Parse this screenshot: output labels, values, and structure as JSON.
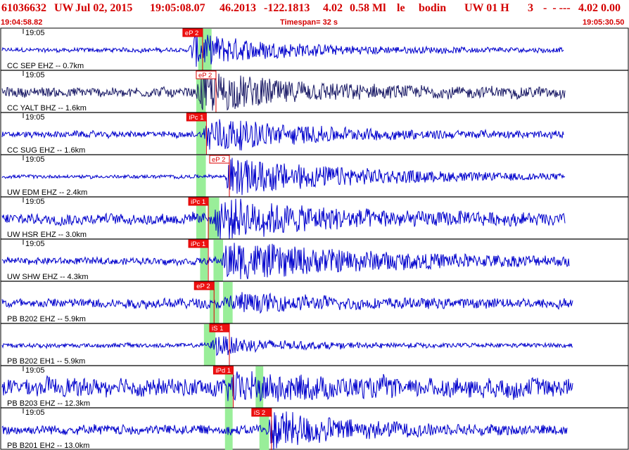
{
  "header": {
    "event_id": "61036632",
    "network": "UW",
    "date": "Jul 02, 2015",
    "time": "19:05:08.07",
    "lat": "46.2013",
    "lon": "-122.1813",
    "depth": "4.02",
    "magnitude": "0.58 Ml",
    "quality": "le",
    "author": "bodin",
    "source": "UW 01 H",
    "count": "3",
    "dashes": "-  - ---",
    "trailer": "4.02 0.00",
    "start_time": "19:04:58.82",
    "timespan_label": "Timespan=  32 s",
    "end_time": "19:05:30.50"
  },
  "chart_data": {
    "type": "line",
    "title": "",
    "x_unit": "s",
    "x_start_time": "19:04:58.82",
    "x_end_time": "19:05:30.50",
    "timespan_s": 32,
    "colors": {
      "trace": "#0000cc",
      "trace_dark": "#1a1a66",
      "pick": "#dd0000",
      "pick_box": "#ee1111",
      "window": "#99ee99",
      "frame": "#000000"
    },
    "traces": [
      {
        "name": "CC SEP EHZ -- 0.7km",
        "tick_label": "19:05",
        "color": "trace",
        "noise": 0.1,
        "amp": 0.85,
        "onset_s": 8.9,
        "decay_s": 4.5,
        "end_s": 28.5,
        "picks": [
          {
            "label": "eP 2",
            "t": 8.6,
            "filled": true
          }
        ],
        "windows": [
          {
            "t0": 9.4,
            "t1": 10.1
          }
        ]
      },
      {
        "name": "CC YALT BHZ -- 1.6km",
        "tick_label": "19:05",
        "color": "trace_dark",
        "noise": 0.22,
        "amp": 0.95,
        "onset_s": 9.3,
        "decay_s": 5.0,
        "end_s": 28.6,
        "picks": [
          {
            "label": "eP 2",
            "t": 9.3,
            "filled": false
          }
        ],
        "windows": [
          {
            "t0": 9.3,
            "t1": 9.8
          }
        ]
      },
      {
        "name": "CC SUG EHZ -- 1.6km",
        "tick_label": "19:05",
        "color": "trace",
        "noise": 0.14,
        "amp": 0.9,
        "onset_s": 9.6,
        "decay_s": 5.0,
        "end_s": 28.5,
        "picks": [
          {
            "label": "iPc 1",
            "t": 8.8,
            "filled": true
          }
        ],
        "windows": [
          {
            "t0": 9.3,
            "t1": 9.8
          }
        ]
      },
      {
        "name": "UW EDM EHZ -- 2.4km",
        "tick_label": "19:05",
        "color": "trace",
        "noise": 0.08,
        "amp": 0.95,
        "onset_s": 10.7,
        "decay_s": 7.0,
        "end_s": 28.6,
        "picks": [
          {
            "label": "eP 2",
            "t": 10.0,
            "filled": false
          }
        ],
        "windows": [
          {
            "t0": 9.3,
            "t1": 9.8
          }
        ]
      },
      {
        "name": "UW HSR EHZ -- 3.0km",
        "tick_label": "19:05",
        "color": "trace",
        "noise": 0.25,
        "amp": 0.95,
        "onset_s": 10.2,
        "decay_s": 5.5,
        "end_s": 28.6,
        "picks": [
          {
            "label": "iPc 1",
            "t": 8.9,
            "filled": true
          }
        ],
        "windows": [
          {
            "t0": 9.3,
            "t1": 9.8
          },
          {
            "t0": 9.9,
            "t1": 10.5
          }
        ]
      },
      {
        "name": "UW SHW EHZ -- 4.3km",
        "tick_label": "19:05",
        "color": "trace",
        "noise": 0.16,
        "amp": 0.9,
        "onset_s": 10.6,
        "decay_s": 8.0,
        "end_s": 28.8,
        "picks": [
          {
            "label": "iPc 1",
            "t": 8.9,
            "filled": true
          }
        ],
        "windows": [
          {
            "t0": 9.5,
            "t1": 9.9
          },
          {
            "t0": 10.2,
            "t1": 10.7
          }
        ]
      },
      {
        "name": "PB B202 EHZ -- 5.9km",
        "tick_label": "",
        "color": "trace",
        "noise": 0.22,
        "amp": 0.4,
        "onset_s": 10.7,
        "decay_s": 4.0,
        "end_s": 29.0,
        "picks": [
          {
            "label": "eP 2",
            "t": 9.2,
            "filled": true
          }
        ],
        "windows": [
          {
            "t0": 10.0,
            "t1": 10.5
          },
          {
            "t0": 10.7,
            "t1": 11.2
          }
        ]
      },
      {
        "name": "PB B202 EH1 -- 5.9km",
        "tick_label": "",
        "color": "trace",
        "noise": 0.1,
        "amp": 0.5,
        "onset_s": 10.0,
        "decay_s": 3.0,
        "end_s": 29.0,
        "picks": [
          {
            "label": "iS 1",
            "t": 10.0,
            "filled": true
          }
        ],
        "windows": [
          {
            "t0": 9.7,
            "t1": 10.3
          }
        ]
      },
      {
        "name": "PB B203 EHZ -- 12.3km",
        "tick_label": "19:05",
        "color": "trace",
        "noise": 0.4,
        "amp": 0.5,
        "onset_s": 10.8,
        "decay_s": 4.0,
        "end_s": 29.0,
        "picks": [
          {
            "label": "iPd 1",
            "t": 10.2,
            "filled": true
          }
        ],
        "windows": [
          {
            "t0": 10.8,
            "t1": 11.2
          },
          {
            "t0": 12.4,
            "t1": 12.8
          }
        ]
      },
      {
        "name": "PB B201 EH2 -- 13.0km",
        "tick_label": "19:05",
        "color": "trace",
        "noise": 0.22,
        "amp": 0.95,
        "onset_s": 13.0,
        "decay_s": 3.5,
        "end_s": 28.7,
        "picks": [
          {
            "label": "iS 2",
            "t": 12.2,
            "filled": true
          }
        ],
        "windows": [
          {
            "t0": 10.8,
            "t1": 11.2
          },
          {
            "t0": 12.6,
            "t1": 13.1
          }
        ]
      }
    ]
  }
}
